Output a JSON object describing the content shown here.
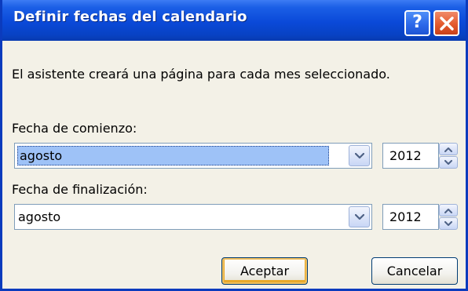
{
  "window": {
    "title": "Definir fechas del calendario"
  },
  "titlebar_buttons": {
    "help_icon": "question-icon",
    "close_icon": "close-icon"
  },
  "content": {
    "intro_text": "El asistente creará una página para cada mes seleccionado.",
    "start": {
      "label": "Fecha de comienzo:",
      "month": "agosto",
      "year": "2012"
    },
    "end": {
      "label": "Fecha de finalización:",
      "month": "agosto",
      "year": "2012"
    }
  },
  "buttons": {
    "ok_label": "Aceptar",
    "cancel_label": "Cancelar"
  },
  "colors": {
    "titlebar": "#0a49d8",
    "close_button": "#e45a2e",
    "selection_highlight": "#9ec2f7",
    "dialog_background": "#f3f1e7"
  }
}
